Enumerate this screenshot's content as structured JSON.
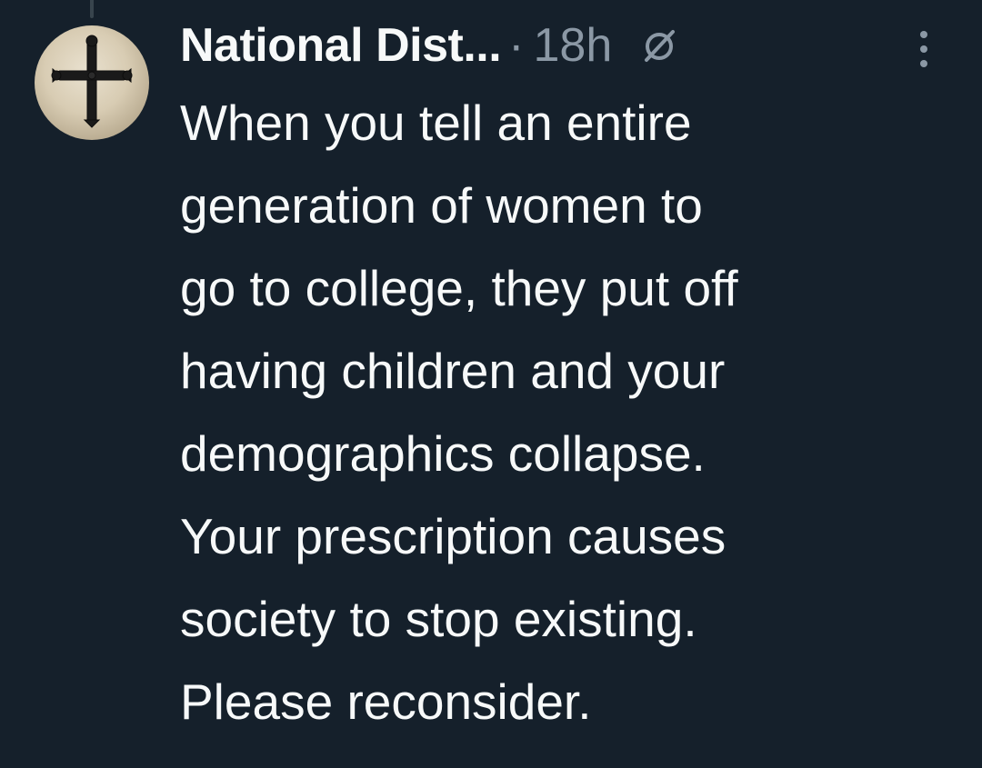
{
  "post": {
    "author": {
      "display_name": "National Dist...",
      "avatar_icon": "orthodox-cross-icon"
    },
    "separator": "·",
    "timestamp": "18h",
    "icons": {
      "status": "slashed-circle-icon",
      "more": "more-options-icon"
    },
    "text_lines": [
      "When you tell an entire",
      "generation of women to",
      "go to college, they put off",
      "having children and your",
      "demographics collapse.",
      "Your prescription causes",
      "society to stop existing.",
      "Please reconsider."
    ]
  },
  "colors": {
    "background": "#15202b",
    "primary_text": "#f7f9f9",
    "secondary_text": "#8b98a5",
    "thread_line": "#38444d"
  }
}
